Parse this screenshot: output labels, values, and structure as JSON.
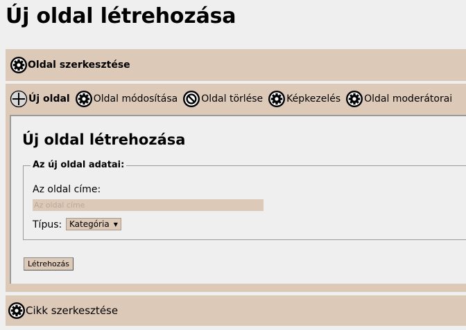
{
  "page": {
    "title": "Új oldal létrehozása"
  },
  "sections": {
    "page_edit": {
      "label": "Oldal szerkesztése",
      "icon": "gear-icon"
    },
    "article_edit": {
      "label": "Cikk szerkesztése",
      "icon": "gear-icon"
    }
  },
  "tabs": [
    {
      "label": "Új oldal",
      "icon": "plus-icon",
      "active": true
    },
    {
      "label": "Oldal módosítása",
      "icon": "gear-icon",
      "active": false
    },
    {
      "label": "Oldal törlése",
      "icon": "no-entry-icon",
      "active": false
    },
    {
      "label": "Képkezelés",
      "icon": "gear-icon",
      "active": false
    },
    {
      "label": "Oldal moderátorai",
      "icon": "gear-icon",
      "active": false
    }
  ],
  "form": {
    "title": "Új oldal létrehozása",
    "legend": "Az új oldal adatai:",
    "name_label": "Az oldal címe:",
    "name_placeholder": "Az oldal címe",
    "name_value": "",
    "type_label": "Típus:",
    "type_selected": "Kategória",
    "submit_label": "Létrehozás"
  },
  "colors": {
    "page_background": "#efefef",
    "accent": "#ddc9b8"
  }
}
